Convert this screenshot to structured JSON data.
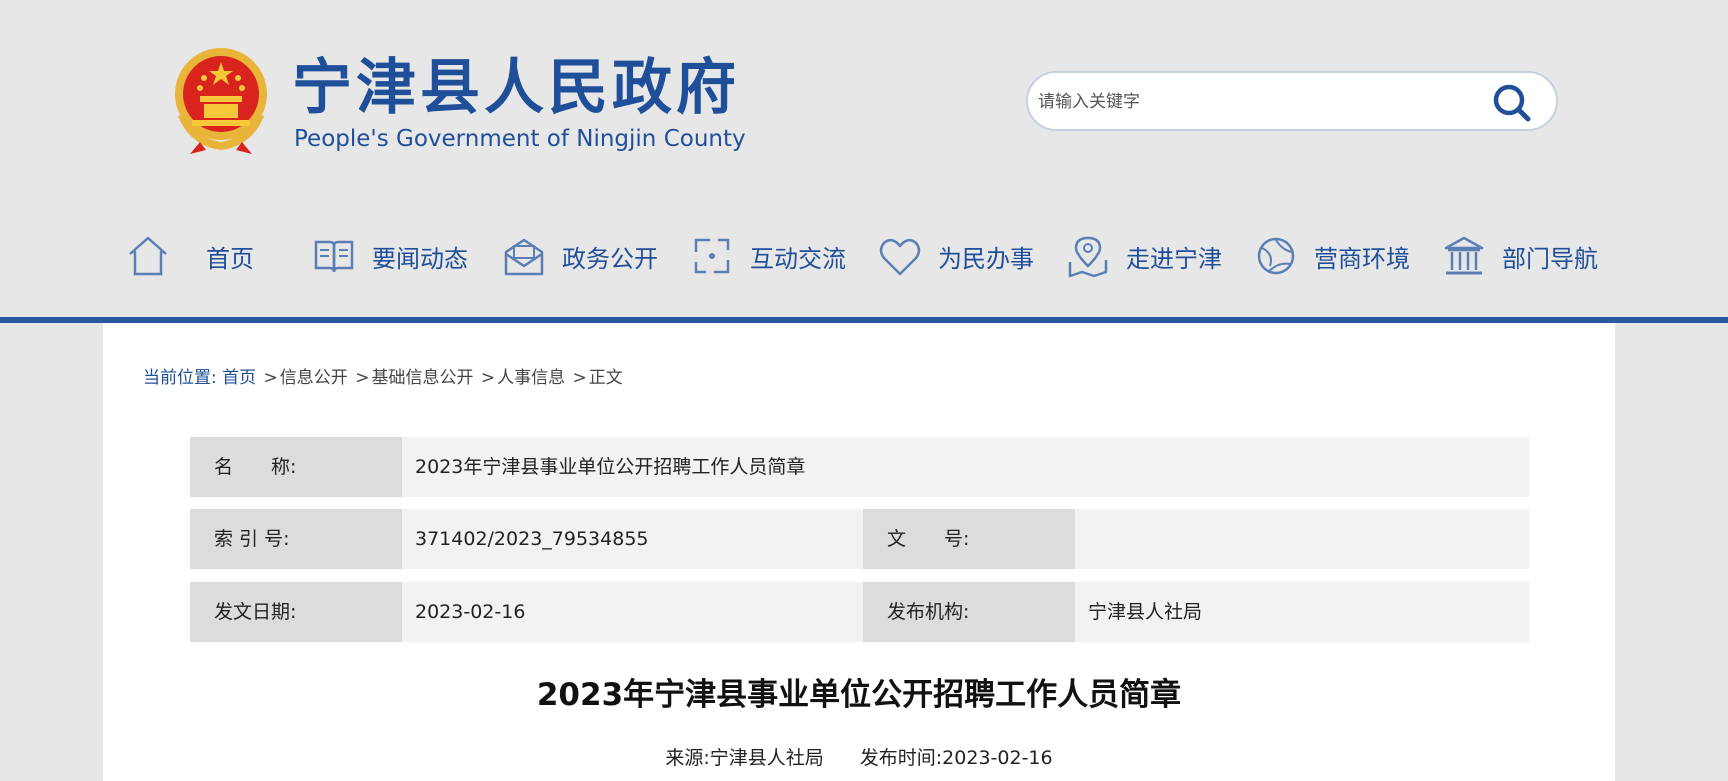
{
  "site": {
    "title_cn": "宁津县人民政府",
    "title_en": "People's Government of Ningjin County"
  },
  "search": {
    "placeholder": "请输入关键字",
    "value": ""
  },
  "nav": [
    {
      "label": "首页",
      "icon": "home-icon"
    },
    {
      "label": "要闻动态",
      "icon": "news-book-icon"
    },
    {
      "label": "政务公开",
      "icon": "mail-icon"
    },
    {
      "label": "互动交流",
      "icon": "interaction-icon"
    },
    {
      "label": "为民办事",
      "icon": "heart-icon"
    },
    {
      "label": "走进宁津",
      "icon": "map-pin-icon"
    },
    {
      "label": "营商环境",
      "icon": "globe-icon"
    },
    {
      "label": "部门导航",
      "icon": "building-icon"
    }
  ],
  "breadcrumb": {
    "current_label": "当前位置:",
    "items": [
      "首页",
      "信息公开",
      "基础信息公开",
      "人事信息",
      "正文"
    ],
    "separator": ">"
  },
  "info": {
    "name_key": "名　　称:",
    "name_value": "2023年宁津县事业单位公开招聘工作人员简章",
    "index_key": "索 引 号:",
    "index_value": "371402/2023_79534855",
    "doc_key": "文　　号:",
    "doc_value": "",
    "date_key": "发文日期:",
    "date_value": "2023-02-16",
    "org_key": "发布机构:",
    "org_value": "宁津县人社局"
  },
  "article": {
    "title": "2023年宁津县事业单位公开招聘工作人员简章",
    "source": "来源:宁津县人社局",
    "published": "发布时间:2023-02-16"
  },
  "colors": {
    "brand_blue": "#1f4f99",
    "bar_blue": "#2b5aa0",
    "header_bg": "#e7e7e8",
    "key_cell_bg": "#dcdcdc",
    "row_bg": "#f2f2f2"
  }
}
